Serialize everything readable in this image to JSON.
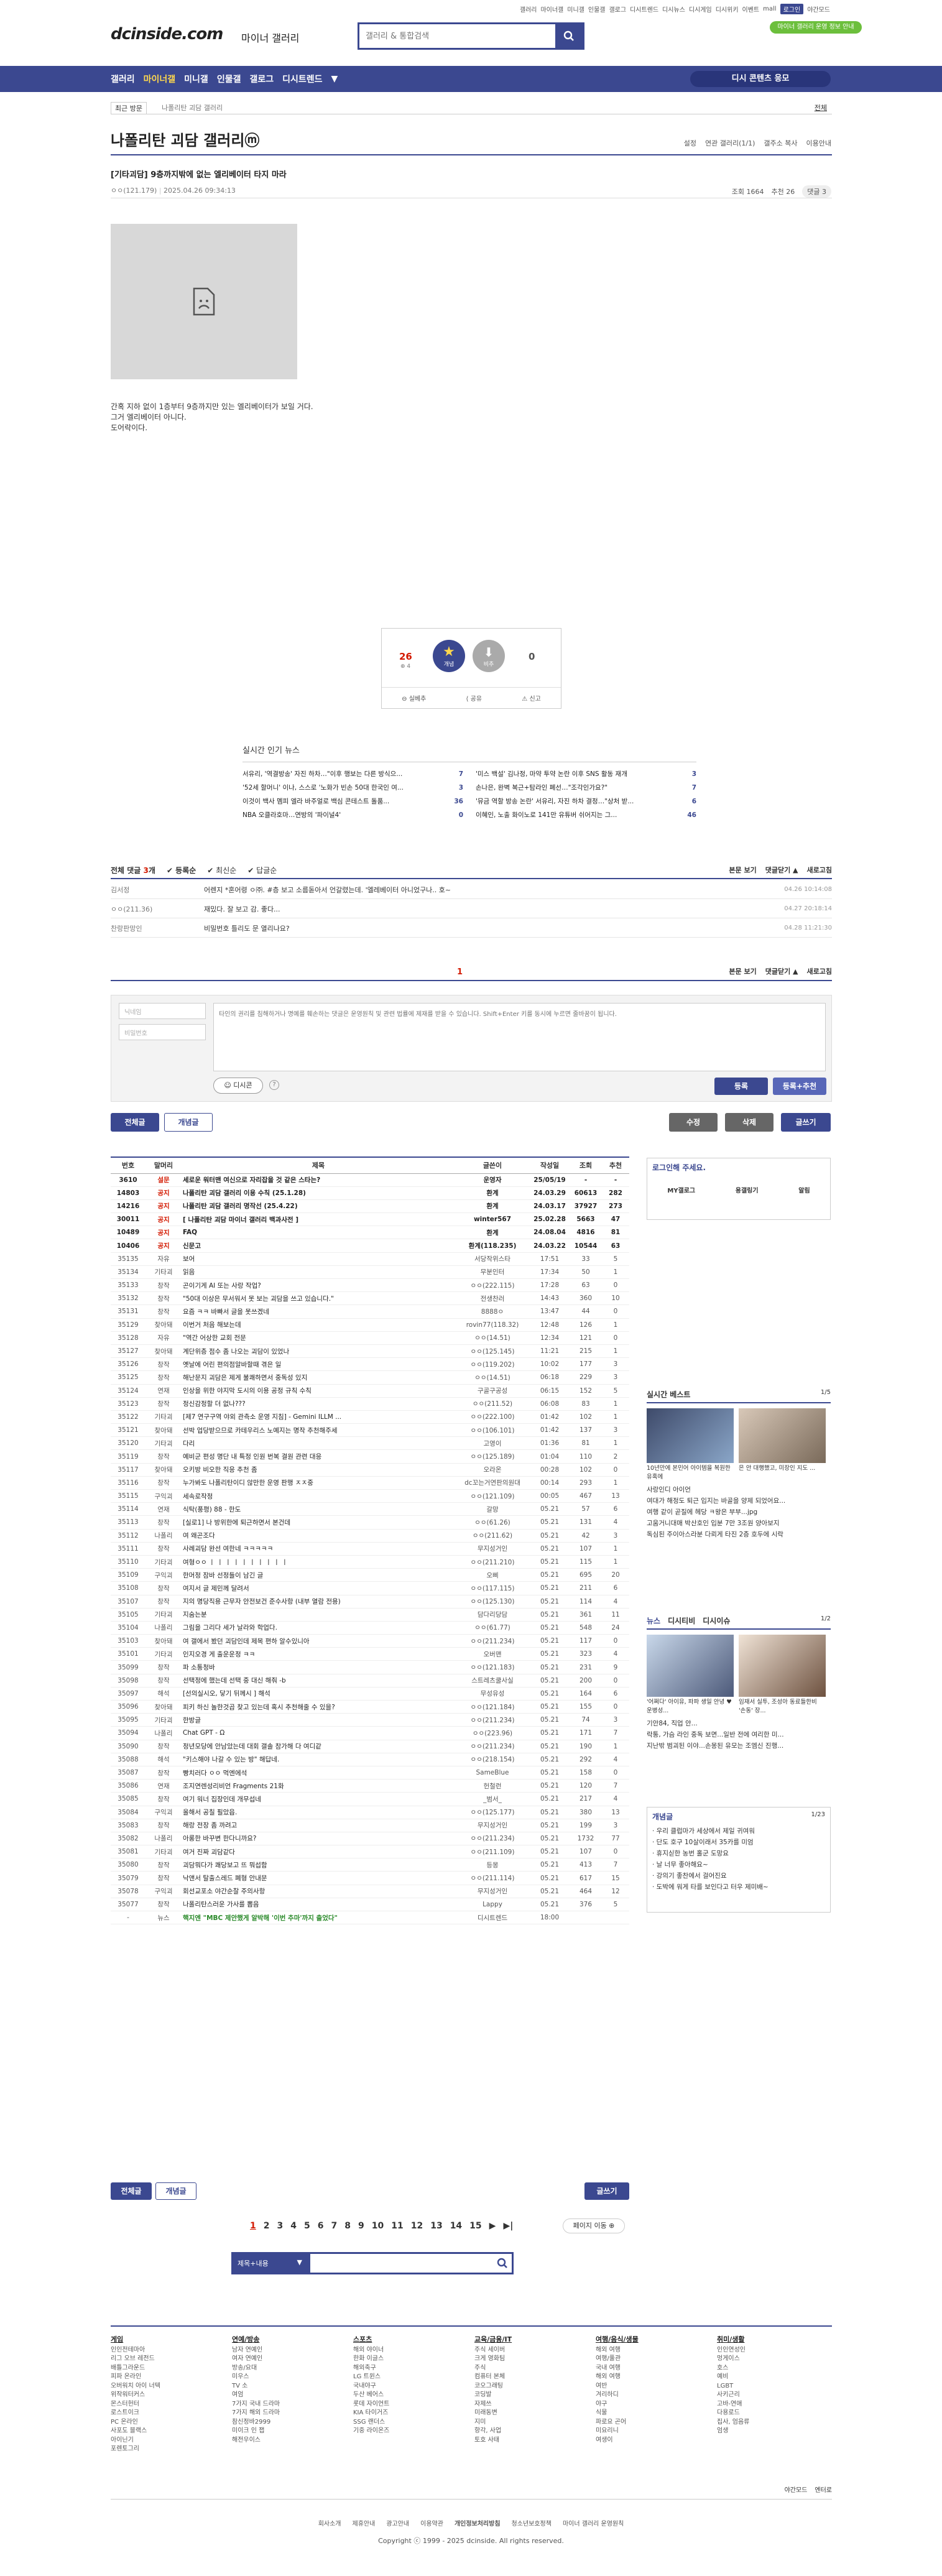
{
  "util": [
    "갤러리",
    "마이너갤",
    "미니갤",
    "인물갤",
    "갤로그",
    "디시트렌드",
    "디시뉴스",
    "디시게임",
    "디시위키",
    "이벤트",
    "mall",
    "로그인",
    "야간모드"
  ],
  "promo": "마이너 갤러리 운영 정보 안내",
  "logo": "dcinside.com",
  "logo_sub": "마이너 갤러리",
  "search": {
    "placeholder": "갤러리 & 통합검색"
  },
  "gnb": {
    "items": [
      "갤러리",
      "마이너갤",
      "미니갤",
      "인물갤",
      "갤로그",
      "디시트렌드",
      "▼"
    ],
    "active": 1,
    "button": "디시 콘텐츠 응모"
  },
  "subnav": {
    "left": "최근 방문",
    "crumb": "나폴리탄 괴담 갤러리",
    "right": "전체"
  },
  "gallery": {
    "title": "나폴리탄 괴담 갤러리ⓜ",
    "tools": [
      "설정",
      "연관 갤러리(1/1)",
      "갤주소 복사",
      "이용안내"
    ]
  },
  "post": {
    "title": "[기타괴담] 9층까지밖에 없는 엘리베이터 타지 마라",
    "author": "ㅇㅇ(121.179)",
    "date": "2025.04.26 09:34:13",
    "views": "조회 1664",
    "recommend": "추천 26",
    "comments": "댓글 3",
    "body": [
      "간혹 지하 없이 1층부터 9층까지만 있는 엘리베이터가 보일 거다.",
      "그거 엘리베이터 아니다.",
      "도어락이다."
    ]
  },
  "rec": {
    "up": 26,
    "up_fixed": 4,
    "up_label": "개념",
    "down_label": "비추",
    "down": 0,
    "actions": [
      "실베추",
      "공유",
      "신고"
    ]
  },
  "news": {
    "title": "실시간 인기 뉴스",
    "items": [
      [
        "서유리, '역결방송' 자진 하차…\"이후 행보는 다른 방식으...",
        "7"
      ],
      [
        "'미스 백설' 김나정, 마약 투약 논란 이후 SNS 활동 재개",
        "3"
      ],
      [
        "'52세 할머니' 이나, 스스로 '노화가 빈손 50대 한국인 여...",
        "3"
      ],
      [
        "손나은, 완벽 복근+탐라인 폐선…\"조각인가요?\"",
        "7"
      ],
      [
        "이것이 백사 멤피 엘라 바주얼로 백심 콘테스트 돌품...",
        "36"
      ],
      [
        "'뮤금 역할 방송 논란' 서유리, 자진 하차 결정…\"상처 받...",
        "6"
      ],
      [
        "NBA 오클라호마…연방의 '파이널4'",
        "0"
      ],
      [
        "이혜인, 노출 화이노로 141만 유튜버 쉬어지는 그...",
        "46"
      ]
    ]
  },
  "comments": {
    "header": {
      "all": "전체 댓글 3개",
      "tabs": [
        "등록순",
        "최신순",
        "답글순"
      ],
      "right": [
        "본문 보기",
        "댓글닫기 ▲",
        "새로고침"
      ]
    },
    "items": [
      {
        "name": "김서정",
        "text": "어렌지 *혼어령 ㅇ㈜. #층 보고 소름돋아서 언갈렸는데. '엘레베이터 아니었구나.. 호~",
        "date": "04.26 10:14:08"
      },
      {
        "name": "ㅇㅇ(211.36)",
        "text": "재밌다. 잘 보고 감. 좋다...",
        "date": "04.27 20:18:14"
      },
      {
        "name": "찬랑판망인",
        "text": "비밀번호 틀리도 문 열리나요?",
        "date": "04.28 11:21:30"
      }
    ],
    "page": "1",
    "form": {
      "nick": "닉네임",
      "pw": "비밀번호",
      "placeholder": "타인의 권리를 침해하거나 명예를 훼손하는 댓글은 운영원칙 및 관련 법률에 제재를 받을 수 있습니다. Shift+Enter 키를 동시에 누르면 줄바꿈이 됩니다.",
      "dccon": "디시콘",
      "submit": "등록",
      "submit2": "등록+추천"
    }
  },
  "board_buttons": {
    "all": "전체글",
    "best": "개념글",
    "mode": "수정",
    "delete": "삭제",
    "write": "글쓰기"
  },
  "list": {
    "headers": [
      "번호",
      "말머리",
      "제목",
      "글쓴이",
      "작성일",
      "조회",
      "추천"
    ],
    "rows": [
      [
        "3610",
        "설문",
        "세로운 워터맨 여신으로 자리잡을 것 같은 스타는?",
        "운영자",
        "25/05/19",
        "-",
        "-",
        "n"
      ],
      [
        "14803",
        "공지",
        "나폴리탄 괴담 갤러리 이용 수칙 (25.1.28)",
        "환계",
        "24.03.29",
        "60613",
        "282",
        "n"
      ],
      [
        "14216",
        "공지",
        "나폴리탄 괴담 갤러리 명작선 (25.4.22)",
        "환계",
        "24.03.17",
        "37927",
        "273",
        "n"
      ],
      [
        "30011",
        "공지",
        "[ 나폴리탄 괴담 마이너 갤러리 백과사전 ]",
        "winter567",
        "25.02.28",
        "5663",
        "47",
        "n"
      ],
      [
        "10489",
        "공지",
        "FAQ",
        "환계",
        "24.08.04",
        "4816",
        "81",
        "n"
      ],
      [
        "10406",
        "공지",
        "신문고",
        "환계(118.235)",
        "24.03.22",
        "10544",
        "63",
        "n"
      ],
      [
        "35135",
        "자유",
        "보어",
        "서당작위스타",
        "17:51",
        "33",
        "5",
        ""
      ],
      [
        "35134",
        "기타괴",
        "읽음",
        "무분인터",
        "17:34",
        "50",
        "1",
        ""
      ],
      [
        "35133",
        "창작",
        "곤이기게 AI 또는 사랑 작업?",
        "ㅇㅇ(222.115)",
        "17:28",
        "63",
        "0",
        ""
      ],
      [
        "35132",
        "창작",
        "\"50대 이상은 무서워서 못 보는 괴담을 쓰고 있습니다.\"",
        "전생찬러",
        "14:43",
        "360",
        "10",
        ""
      ],
      [
        "35131",
        "창작",
        "요즘 ㅋㅋ 바빠서 글을 못쓰겠네",
        "8888ㅇ",
        "13:47",
        "44",
        "0",
        ""
      ],
      [
        "35129",
        "찾아돼",
        "이번거 처음 해보는데",
        "rovin77(118.32)",
        "12:48",
        "126",
        "1",
        ""
      ],
      [
        "35128",
        "자유",
        "\"역간 어상한 교회 전문",
        "ㅇㅇ(14.51)",
        "12:34",
        "121",
        "0",
        ""
      ],
      [
        "35127",
        "찾아돼",
        "계단위층 점수 좀 나오는 괴담이 있었나",
        "ㅇㅇ(125.145)",
        "11:21",
        "215",
        "1",
        ""
      ],
      [
        "35126",
        "창작",
        "옛날에 어린 편의점알바할때 겪은 일",
        "ㅇㅇ(119.202)",
        "10:02",
        "177",
        "3",
        ""
      ],
      [
        "35125",
        "창작",
        "해난문지 괴담은 제게 불쾌하면서 중독성 있지",
        "ㅇㅇ(14.51)",
        "06:18",
        "229",
        "3",
        ""
      ],
      [
        "35124",
        "연재",
        "인상을 위한 야지막 도시의 이용 공정 규칙 수칙",
        "구골구공성",
        "06:15",
        "152",
        "5",
        ""
      ],
      [
        "35123",
        "창작",
        "정신감정할 더 없나???",
        "ㅇㅇ(211.52)",
        "06:08",
        "83",
        "1",
        ""
      ],
      [
        "35122",
        "기타괴",
        "[제7 연구구역 야외 관측소 운영 지침] - Gemini ILLM ...",
        "ㅇㅇ(222.100)",
        "01:42",
        "102",
        "1",
        ""
      ],
      [
        "35121",
        "찾아돼",
        "선박 업당받으므로 카테우리스 노예지는 명작 추천해주세",
        "ㅇㅇ(106.101)",
        "01:42",
        "137",
        "3",
        ""
      ],
      [
        "35120",
        "기타괴",
        "다리",
        "고영이",
        "01:36",
        "81",
        "1",
        ""
      ],
      [
        "35119",
        "창작",
        "예비군 편성 명단 내 특정 인원 번복 결원 관련 대응",
        "ㅇㅇ(125.189)",
        "01:04",
        "110",
        "2",
        ""
      ],
      [
        "35117",
        "찾아돼",
        "오키방 비오한 직응 추천 좀",
        "오라온",
        "00:28",
        "102",
        "0",
        ""
      ],
      [
        "35116",
        "창작",
        "누가봐도 나폴리탄이디 않만한 운영 판행 ㅈㅈ중",
        "dc꼬는거연판의원대",
        "00:14",
        "293",
        "1",
        ""
      ],
      [
        "35115",
        "구익괴",
        "세속로작정",
        "ㅇㅇ(121.109)",
        "00:05",
        "467",
        "13",
        ""
      ],
      [
        "35114",
        "연재",
        "식탁(풍평) 88 - 한도",
        "갈망",
        "05.21",
        "57",
        "6",
        ""
      ],
      [
        "35113",
        "창작",
        "[실로1] 나 방위한에 퇴근하면서 본건데",
        "ㅇㅇ(61.26)",
        "05.21",
        "131",
        "4",
        ""
      ],
      [
        "35112",
        "나폴리",
        "여 왜곤조다",
        "ㅇㅇ(211.62)",
        "05.21",
        "42",
        "3",
        ""
      ],
      [
        "35111",
        "창작",
        "사례괴담 완선 여한네 ㅋㅋㅋㅋㅋ",
        "무지성거인",
        "05.21",
        "107",
        "1",
        ""
      ],
      [
        "35110",
        "기타괴",
        "여형ㅇㅇ ㅣ ㅣ ㅣ ㅣ ㅣ ㅣ ㅣ ㅣ ㅣ ㅣ",
        "ㅇㅇ(211.210)",
        "05.21",
        "115",
        "1",
        ""
      ],
      [
        "35109",
        "구익괴",
        "한머정 잠바 선정들이 남긴 글",
        "오삐",
        "05.21",
        "695",
        "20",
        ""
      ],
      [
        "35108",
        "창작",
        "여지서 글 제민께 달려서",
        "ㅇㅇ(117.115)",
        "05.21",
        "211",
        "6",
        ""
      ],
      [
        "35107",
        "창작",
        "지의 명당직용 근무자 안전보건 준수사항 (내부 열람 전용)",
        "ㅇㅇ(125.130)",
        "05.21",
        "114",
        "4",
        ""
      ],
      [
        "35105",
        "기타괴",
        "지숨는분",
        "담다리당담",
        "05.21",
        "361",
        "11",
        ""
      ],
      [
        "35104",
        "나폴리",
        "그림을 그리다 세가 날라와 학업다.",
        "ㅇㅇ(61.77)",
        "05.21",
        "548",
        "24",
        ""
      ],
      [
        "35103",
        "찾아돼",
        "여 갤에서 봤던 괴담인데 제목 편하 알수있니아",
        "ㅇㅇ(211.234)",
        "05.21",
        "117",
        "0",
        ""
      ],
      [
        "35101",
        "기타괴",
        "인지오경 게 출운운정 ㅋㅋ",
        "오버맨",
        "05.21",
        "323",
        "4",
        ""
      ],
      [
        "35099",
        "창작",
        "파 소통청바",
        "ㅇㅇ(121.183)",
        "05.21",
        "231",
        "9",
        ""
      ],
      [
        "35098",
        "창작",
        "선택정에 했는데 선택 중 대신 해줘 -b",
        "스트레츠쿨사실",
        "05.21",
        "200",
        "0",
        ""
      ],
      [
        "35097",
        "해석",
        "[선의실시오, 닿기 뒤께시 ] 해석",
        "무성유성",
        "05.21",
        "164",
        "6",
        ""
      ],
      [
        "35096",
        "찾아돼",
        "피키 하신 놀한것곱 찾고 있는데 혹시 추천해줄 수 있을?",
        "ㅇㅇ(121.184)",
        "05.21",
        "155",
        "0",
        ""
      ],
      [
        "35095",
        "기타괴",
        "한방글",
        "ㅇㅇ(211.234)",
        "05.21",
        "74",
        "3",
        ""
      ],
      [
        "35094",
        "나폴리",
        "Chat GPT - Ω",
        "ㅇㅇ(223.96)",
        "05.21",
        "171",
        "7",
        ""
      ],
      [
        "35090",
        "창작",
        "정년모당에 안남았는데 대회 갤솔 참가해 다 여디같",
        "ㅇㅇ(211.234)",
        "05.21",
        "190",
        "1",
        ""
      ],
      [
        "35088",
        "해석",
        "\"키스해야 나갈 수 있는 방\" 해답네.",
        "ㅇㅇ(218.154)",
        "05.21",
        "292",
        "4",
        ""
      ],
      [
        "35087",
        "창작",
        "빵치러다 ㅇㅇ 먹엔에석",
        "SameBlue",
        "05.21",
        "158",
        "0",
        ""
      ],
      [
        "35086",
        "연재",
        "조지연렌성리비언 Fragments 21화",
        "헌철런",
        "05.21",
        "120",
        "7",
        ""
      ],
      [
        "35085",
        "창작",
        "여기 워너 집장인데 개무섭네",
        "_범서_",
        "05.21",
        "217",
        "4",
        ""
      ],
      [
        "35084",
        "구익괴",
        "올해서 공칠 필았읍.",
        "ㅇㅇ(125.177)",
        "05.21",
        "380",
        "13",
        ""
      ],
      [
        "35083",
        "창작",
        "해랑 전장 좀 까려고",
        "무지성거인",
        "05.21",
        "199",
        "3",
        ""
      ],
      [
        "35082",
        "나폴리",
        "아롱한 바꾸변 한다니까요?",
        "ㅇㅇ(211.234)",
        "05.21",
        "1732",
        "77",
        ""
      ],
      [
        "35081",
        "기타괴",
        "여거 진짜 괴담같다",
        "ㅇㅇ(211.109)",
        "05.21",
        "107",
        "0",
        ""
      ],
      [
        "35080",
        "창작",
        "괴담뭐다가 쾌당보고 뜨 뭐섭함",
        "등몽",
        "05.21",
        "413",
        "7",
        ""
      ],
      [
        "35079",
        "창작",
        "낙앤서 탈출스레드 폐형 안내문",
        "ㅇㅇ(211.114)",
        "05.21",
        "617",
        "15",
        ""
      ],
      [
        "35078",
        "구익괴",
        "회선교포소 야간순찰 주의사항",
        "무지성거인",
        "05.21",
        "464",
        "12",
        ""
      ],
      [
        "35077",
        "창작",
        "나폴리탄스러운 가사를 뽑음",
        "Lappy",
        "05.21",
        "376",
        "5",
        ""
      ],
      [
        "-",
        "뉴스",
        "핵지엔 \"MBC 제안했게 알박해 '이번 추마'까지 출었다\"",
        "디시트렌드",
        "18:00",
        "",
        "",
        " ad"
      ]
    ]
  },
  "list_buttons": {
    "all": "전체글",
    "best": "개념글",
    "write": "글쓰기"
  },
  "pager": [
    "1",
    "2",
    "3",
    "4",
    "5",
    "6",
    "7",
    "8",
    "9",
    "10",
    "11",
    "12",
    "13",
    "14",
    "15",
    "▶",
    "▶|"
  ],
  "page_move": "페이지 이동 ⊕",
  "search_bottom": {
    "option": "제목+내용"
  },
  "side": {
    "login_title": "로그인해 주세요.",
    "login_items": [
      "MY갤로그",
      "용갤링기",
      "알림"
    ],
    "best_title": "실시간 베스트",
    "best_page": "1/5",
    "best_caps": [
      "10년만에 본민어 아이템을 복원한 유혹에",
      "은 안 대행했고, 미장인 지도 ..."
    ],
    "best_items": [
      "사랑인디 아이언",
      "여대가 해정도 퇴근 입지는 바골을 양제 되었어요...",
      "여행 같이 곧질에 헤당 ㅋ왕은 부부...jpg",
      "고움거니대매 박산호인 입분 7만 3조원 양아보지",
      "독심된 주이아스라분 다뢰게 타진 2층 호두에 시락"
    ],
    "news_tabs": [
      "뉴스",
      "디시티비",
      "디시이슈"
    ],
    "news_page": "1/2",
    "news_caps": [
      "'어쩌다' 아이유, 파파 생일 안녕 ♥운병성...",
      "임재서 실투, 조성아 동료들한비 '손동' 장..."
    ],
    "news_items": [
      "기안84, 직업 안...",
      "락통, 가슴 라인 중독 보면...일반 전에 여리한 미...",
      "지난밖 범괴된 이야...손몽된 유모는 조엠신 진행..."
    ],
    "concept_title": "개념글",
    "concept_page": "1/23",
    "concept_items": [
      "우리 클럽마가 세상에서 제일 귀여워",
      "단도 호구 10살이래서 35카를 미엄",
      "휴지싣한 농번 홀군 도망요",
      "날 너무 좋아해요~",
      "강의기 좋찬에서 걸어진요",
      "도박에 워게 타를 보인다고 터우 제미배~"
    ]
  },
  "footer": {
    "cols": [
      {
        "title": "게임",
        "items": [
          "인인전테마아",
          "리그 오브 레전드",
          "배틀그라운드",
          "피파 온라인",
          "오버워치 아이 너텍",
          "위작워터커스",
          "몬스터헌터",
          "로스트이크",
          "PC 온라인",
          "사포도 블랙스",
          "아이닌기",
          "포렌토그리"
        ]
      },
      {
        "title": "연예/방송",
        "items": [
          "남자 연예인",
          "여자 연예인",
          "방송/요대",
          "미우스",
          "TV 소",
          "여엄",
          "7가지 국내 드라마",
          "7가지 해외 드라마",
          "참신정바2999",
          "미이크 인 잽",
          "해전우이스"
        ]
      },
      {
        "title": "스포츠",
        "items": [
          "해외 야이너",
          "한화 이글스",
          "해외축구",
          "LG 트윈스",
          "국내야구",
          "두산 베어스",
          "롯데 자이언트",
          "KIA 타이거즈",
          "SSG 랜더스",
          "기중 라이온즈"
        ]
      },
      {
        "title": "교육/금융/IT",
        "items": [
          "주식 세이버",
          "크게 영화팀",
          "주식",
          "컴퓨터 본체",
          "코오그래팅",
          "코딩발",
          "자제쓰",
          "미래동변",
          "지미",
          "항각, 사업",
          "토호 사태"
        ]
      },
      {
        "title": "여행/음식/생물",
        "items": [
          "해외 여행",
          "여행/풀관",
          "국내 여행",
          "해외 여행",
          "여반",
          "겨리하디",
          "야구",
          "식물",
          "파로요 곤어",
          "미요리니",
          "여생이"
        ]
      },
      {
        "title": "취미/생활",
        "items": [
          "인인연성인",
          "멍게이스",
          "호스",
          "예비",
          "LGBT",
          "사키근리",
          "고바-연애",
          "다용로드",
          "집사, 엄음류",
          "엄생"
        ]
      }
    ],
    "util": [
      "야간모드",
      "엔터로"
    ],
    "links": [
      "회사소개",
      "제휴안내",
      "광고안내",
      "이용약관",
      "개인정보처리방침",
      "청소년보호정책",
      "마이너 갤러리 운영원칙"
    ],
    "copyright": "Copyright ⓒ 1999 - 2025 dcinside. All rights reserved."
  }
}
